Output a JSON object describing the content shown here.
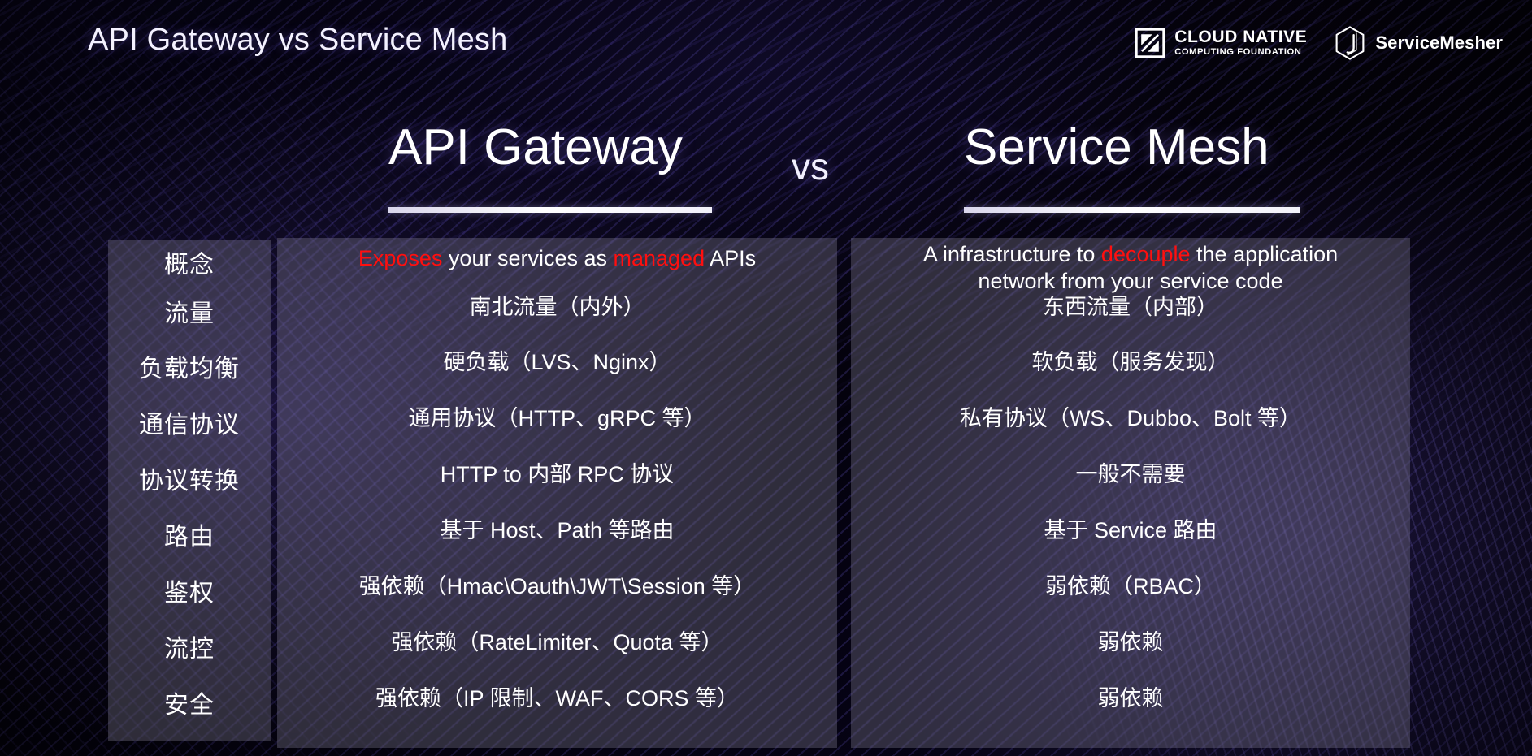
{
  "slide": {
    "title": "API Gateway vs Service Mesh"
  },
  "logos": {
    "cncf": {
      "icon": "cncf-square-logo-icon",
      "line1": "CLOUD NATIVE",
      "line2": "COMPUTING FOUNDATION"
    },
    "servicemesher": {
      "icon": "servicemesher-hexagon-logo-icon",
      "label": "ServiceMesher"
    }
  },
  "comparison": {
    "left_heading": "API Gateway",
    "vs_label": "vs",
    "right_heading": "Service Mesh"
  },
  "row_labels": [
    "概念",
    "流量",
    "负载均衡",
    "通信协议",
    "协议转换",
    "路由",
    "鉴权",
    "流控",
    "安全"
  ],
  "api_gateway": {
    "concept_pre": "",
    "concept_hl1": "Exposes",
    "concept_mid": " your services as ",
    "concept_hl2": "managed",
    "concept_post": " APIs",
    "rows": [
      "南北流量（内外）",
      "硬负载（LVS、Nginx）",
      "通用协议（HTTP、gRPC 等）",
      "HTTP to 内部 RPC 协议",
      "基于 Host、Path 等路由",
      "强依赖（Hmac\\Oauth\\JWT\\Session 等）",
      "强依赖（RateLimiter、Quota 等）",
      "强依赖（IP 限制、WAF、CORS 等）"
    ]
  },
  "service_mesh": {
    "concept_pre": "A infrastructure to ",
    "concept_hl1": "decouple",
    "concept_post": " the application",
    "concept_line2": "network from your service code",
    "rows": [
      "东西流量（内部）",
      "软负载（服务发现）",
      "私有协议（WS、Dubbo、Bolt 等）",
      "一般不需要",
      "基于 Service 路由",
      "弱依赖（RBAC）",
      "弱依赖",
      "弱依赖"
    ]
  },
  "colors": {
    "highlight_red": "#ff0f0f",
    "text_white": "#ffffff",
    "panel_fill": "rgba(168,164,186,0.27)",
    "background_dark": "#04020a",
    "accent_purple": "#5c4eba"
  }
}
